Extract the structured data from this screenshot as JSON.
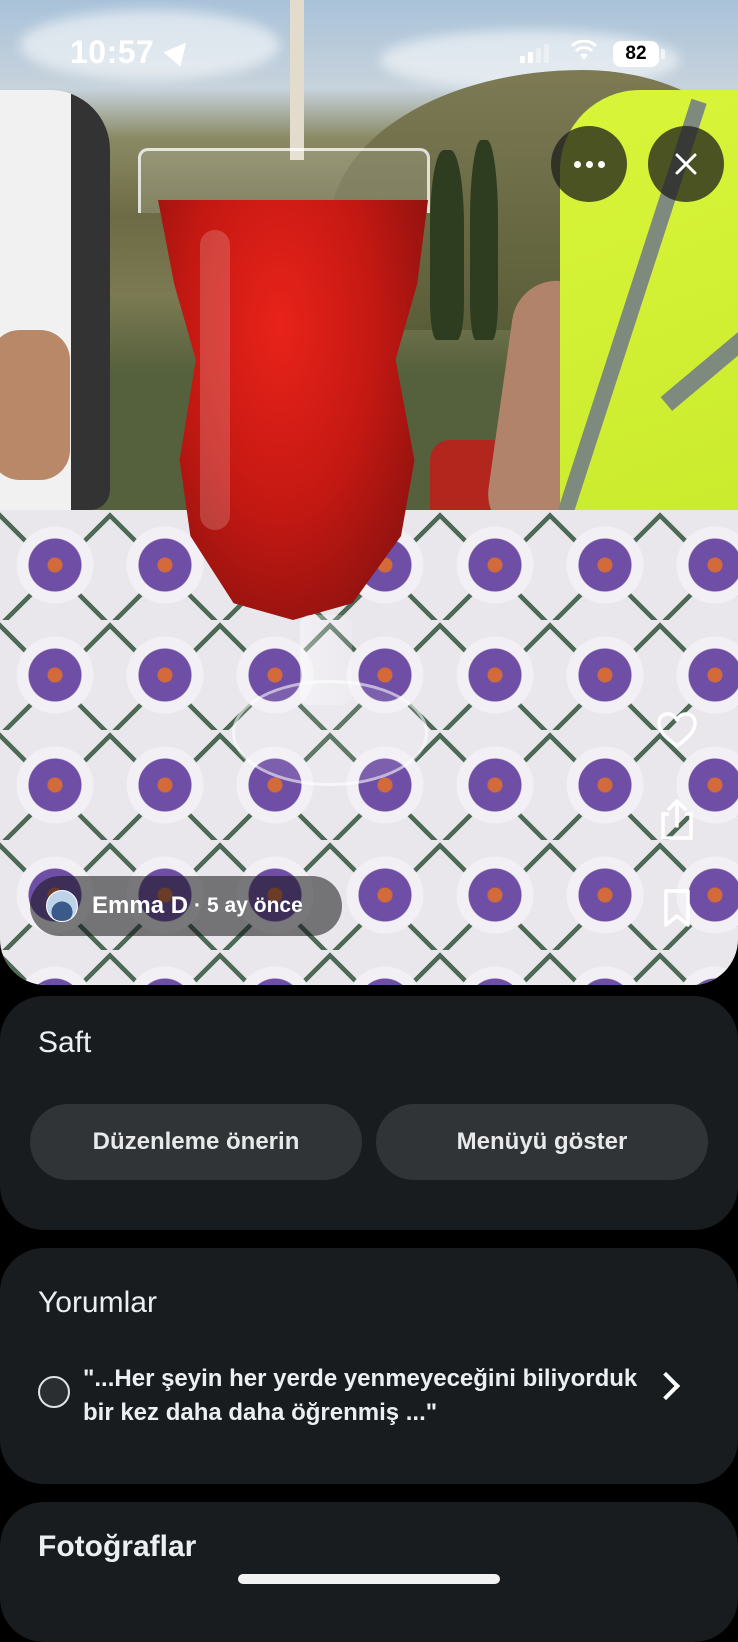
{
  "status_bar": {
    "time": "10:57",
    "battery": "82",
    "icons": [
      "location-arrow-icon",
      "cellular-signal-icon",
      "wifi-icon",
      "battery-icon"
    ]
  },
  "photo": {
    "author_name": "Emma D",
    "separator": "·",
    "posted_ago": "5 ay önce",
    "buttons": [
      "more-options-icon",
      "close-icon",
      "heart-icon",
      "share-icon",
      "bookmark-icon"
    ]
  },
  "place": {
    "name": "Saft",
    "suggest_edit_label": "Düzenleme önerin",
    "show_menu_label": "Menüyü göster"
  },
  "reviews": {
    "title": "Yorumlar",
    "snippet": "\"...Her şeyin her yerde yenmeyeceğini biliyorduk bir kez daha daha öğrenmiş ...\""
  },
  "photos_section": {
    "title": "Fotoğraflar"
  },
  "colors": {
    "background": "#000000",
    "card": "#181c1e",
    "pill": "#303436",
    "text": "#eceff1"
  }
}
